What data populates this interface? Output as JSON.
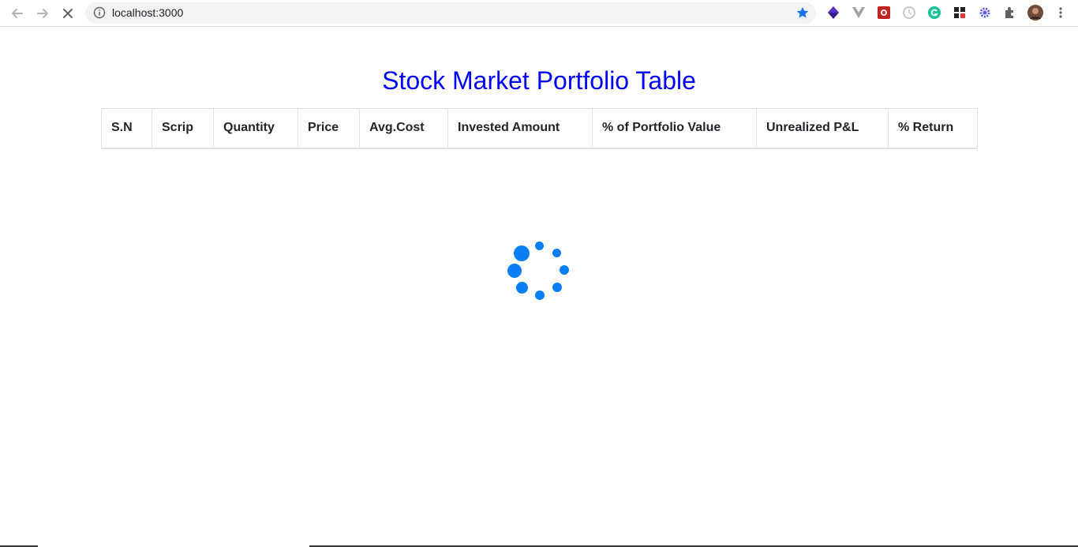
{
  "browser": {
    "url": "localhost:3000",
    "icons": [
      "back-icon",
      "forward-icon",
      "stop-icon",
      "info-icon",
      "star-icon",
      "extensions-icon",
      "menu-icon"
    ]
  },
  "page": {
    "title": "Stock Market Portfolio Table",
    "title_color": "#0000ff"
  },
  "table": {
    "headers": [
      "S.N",
      "Scrip",
      "Quantity",
      "Price",
      "Avg.Cost",
      "Invested Amount",
      "% of Portfolio Value",
      "Unrealized P&L",
      "% Return"
    ]
  },
  "spinner": {
    "color": "#0a7ff5",
    "state": "loading"
  }
}
